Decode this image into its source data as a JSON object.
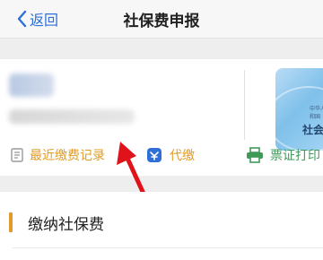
{
  "header": {
    "back_label": "返回",
    "title": "社保费申报"
  },
  "profile": {
    "card_subtitle": "中华人民共和国",
    "card_title": "社会保障卡"
  },
  "actions": {
    "recent_records": "最近缴费记录",
    "agent_pay": "代缴",
    "print": "票证打印"
  },
  "section": {
    "title": "缴纳社保费"
  },
  "colors": {
    "accent_blue": "#2f6fd6",
    "accent_orange": "#e39c26",
    "print_green": "#3f9a5a",
    "arrow_red": "#e1131a"
  }
}
